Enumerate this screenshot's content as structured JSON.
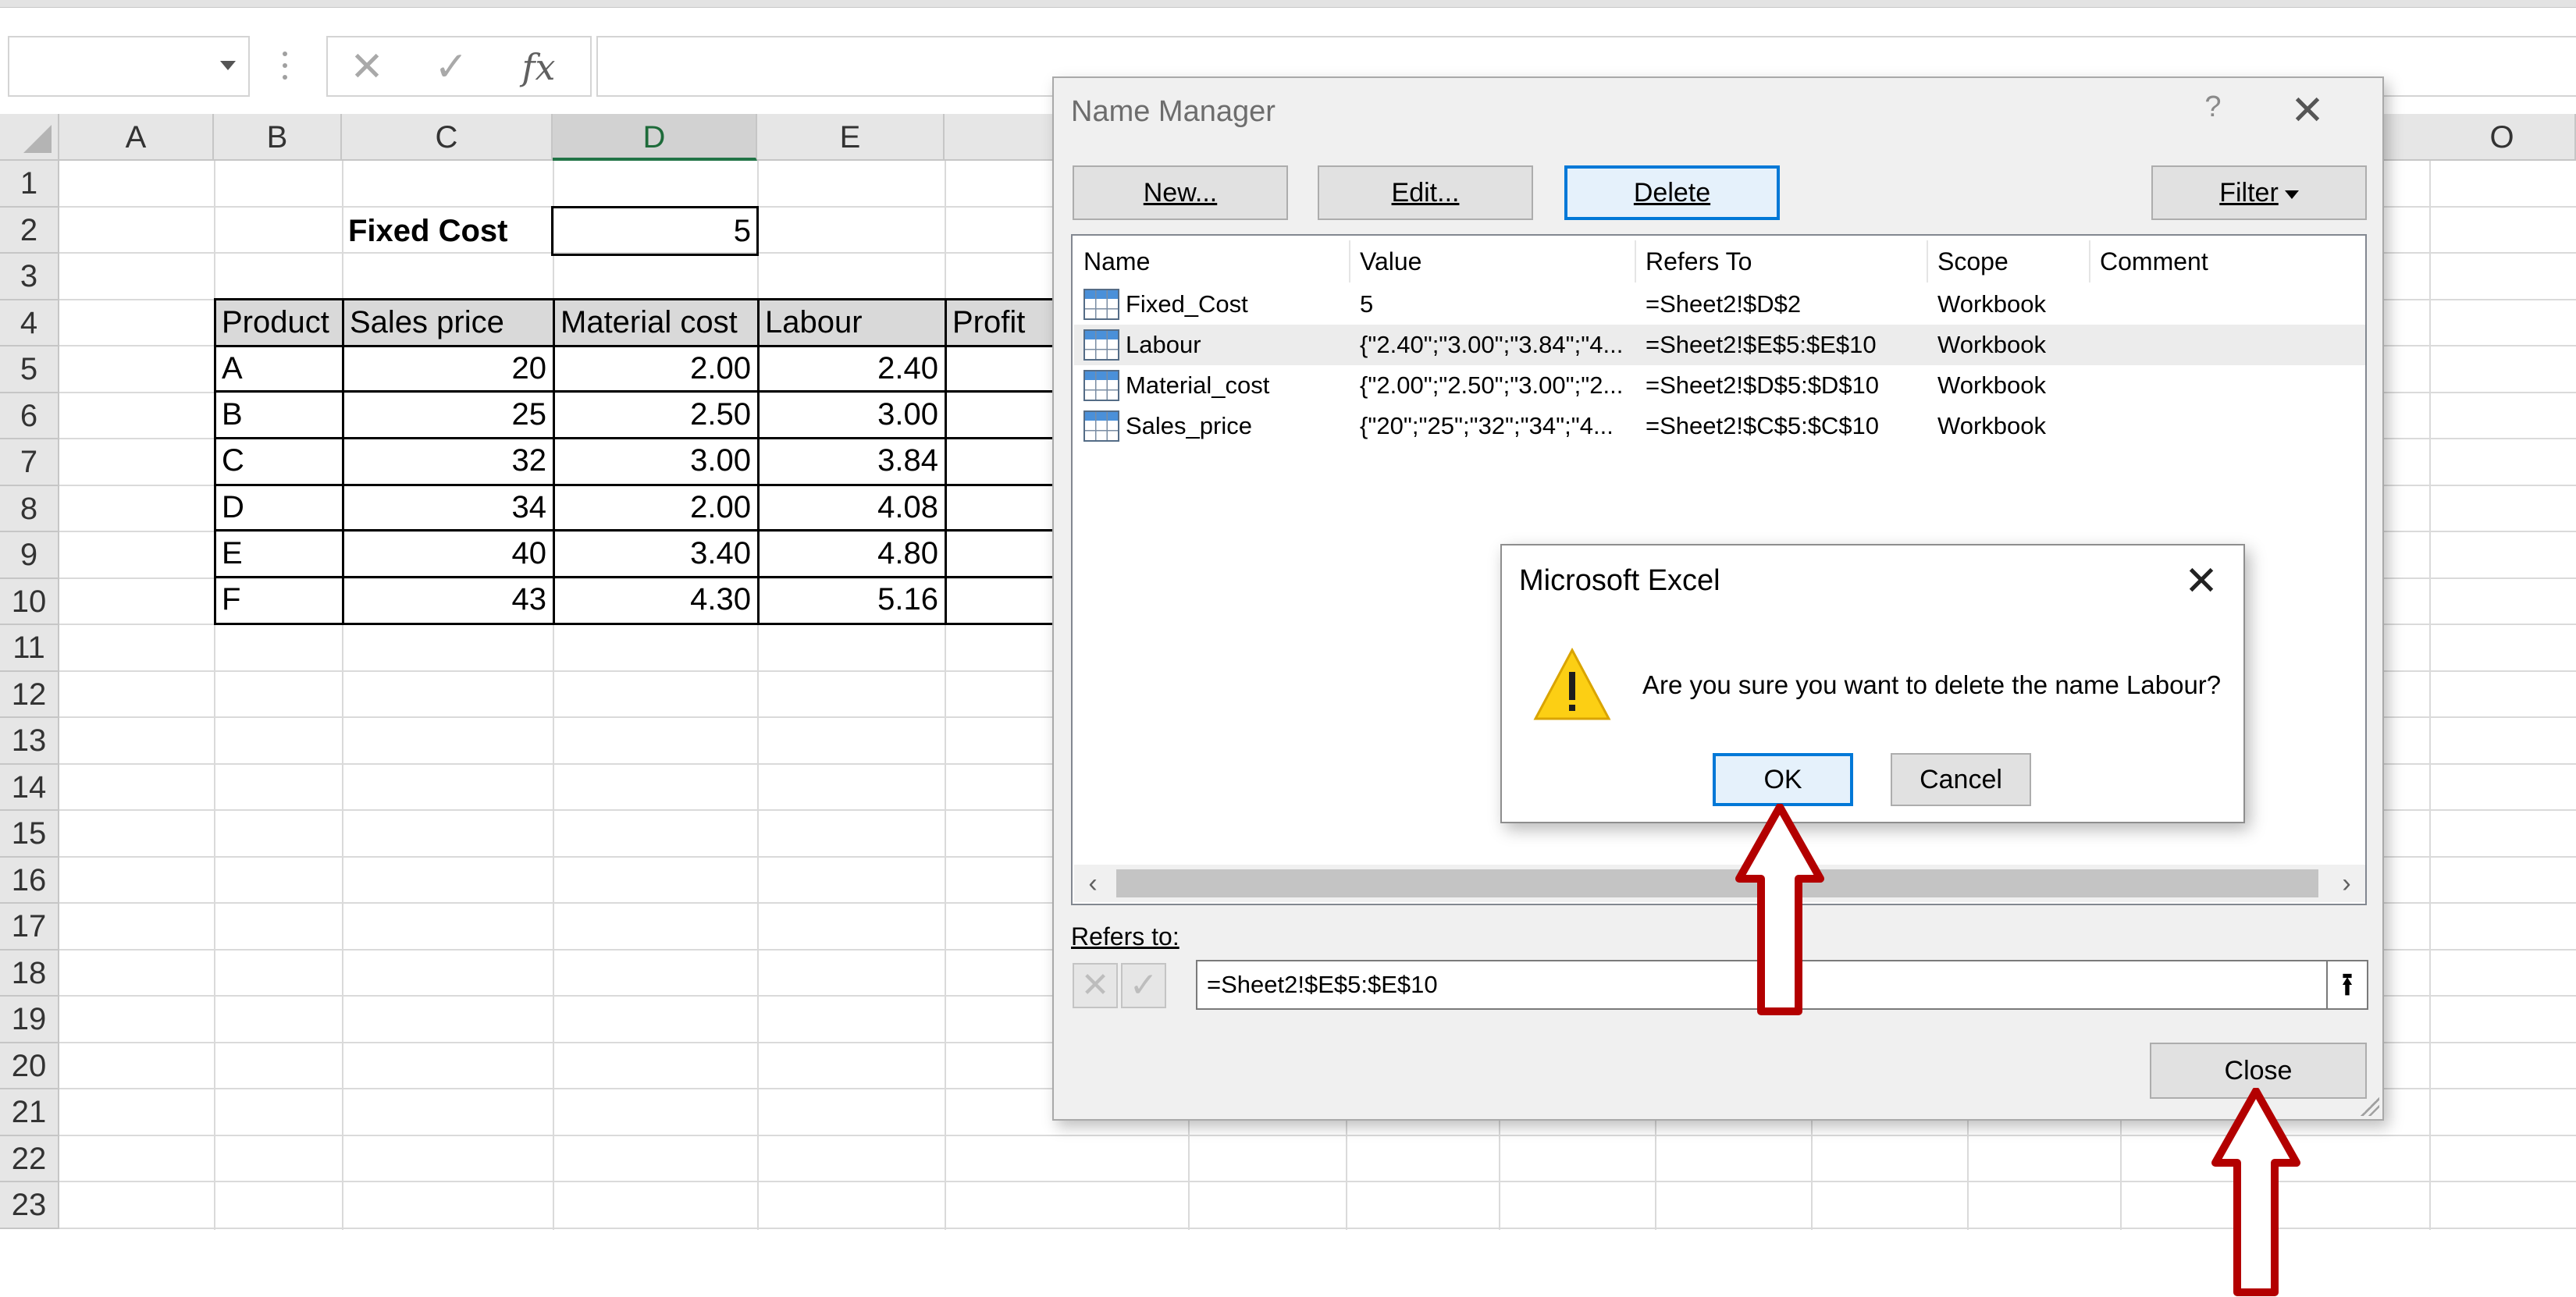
{
  "formula_bar": {
    "name_box": "",
    "cancel_icon": "✕",
    "enter_icon": "✓",
    "fx_icon": "fx",
    "formula": ""
  },
  "columns": [
    "A",
    "B",
    "C",
    "D",
    "E",
    "",
    "",
    "",
    "",
    "",
    "",
    "",
    "O"
  ],
  "rows": [
    "1",
    "2",
    "3",
    "4",
    "5",
    "6",
    "7",
    "8",
    "9",
    "10",
    "11",
    "12",
    "13",
    "14",
    "15",
    "16",
    "17",
    "18",
    "19",
    "20",
    "21",
    "22",
    "23"
  ],
  "sheet": {
    "fixed_cost_label": "Fixed Cost",
    "fixed_cost_value": "5",
    "table_headers": [
      "Product",
      "Sales price",
      "Material cost",
      "Labour",
      "Profit"
    ],
    "table_rows": [
      [
        "A",
        "20",
        "2.00",
        "2.40"
      ],
      [
        "B",
        "25",
        "2.50",
        "3.00"
      ],
      [
        "C",
        "32",
        "3.00",
        "3.84"
      ],
      [
        "D",
        "34",
        "2.00",
        "4.08"
      ],
      [
        "E",
        "40",
        "3.40",
        "4.80"
      ],
      [
        "F",
        "43",
        "4.30",
        "5.16"
      ]
    ]
  },
  "name_manager": {
    "title": "Name Manager",
    "help": "?",
    "close_x": "✕",
    "buttons": {
      "new": "New...",
      "edit": "Edit...",
      "delete": "Delete",
      "filter": "Filter"
    },
    "columns": [
      "Name",
      "Value",
      "Refers To",
      "Scope",
      "Comment"
    ],
    "names": [
      {
        "name": "Fixed_Cost",
        "value": "5",
        "refers_to": "=Sheet2!$D$2",
        "scope": "Workbook",
        "comment": ""
      },
      {
        "name": "Labour",
        "value": "{\"2.40\";\"3.00\";\"3.84\";\"4...",
        "refers_to": "=Sheet2!$E$5:$E$10",
        "scope": "Workbook",
        "comment": ""
      },
      {
        "name": "Material_cost",
        "value": "{\"2.00\";\"2.50\";\"3.00\";\"2...",
        "refers_to": "=Sheet2!$D$5:$D$10",
        "scope": "Workbook",
        "comment": ""
      },
      {
        "name": "Sales_price",
        "value": "{\"20\";\"25\";\"32\";\"34\";\"4...",
        "refers_to": "=Sheet2!$C$5:$C$10",
        "scope": "Workbook",
        "comment": ""
      }
    ],
    "refers_to_label": "Refers to:",
    "refers_to_value": "=Sheet2!$E$5:$E$10",
    "close_button": "Close"
  },
  "confirm_dialog": {
    "title": "Microsoft Excel",
    "close_x": "✕",
    "message": "Are you sure you want to delete the name Labour?",
    "ok": "OK",
    "cancel": "Cancel"
  },
  "colors": {
    "annotation_arrow": "#b30000",
    "focus_border": "#0078d7",
    "selected_header": "#217346"
  }
}
